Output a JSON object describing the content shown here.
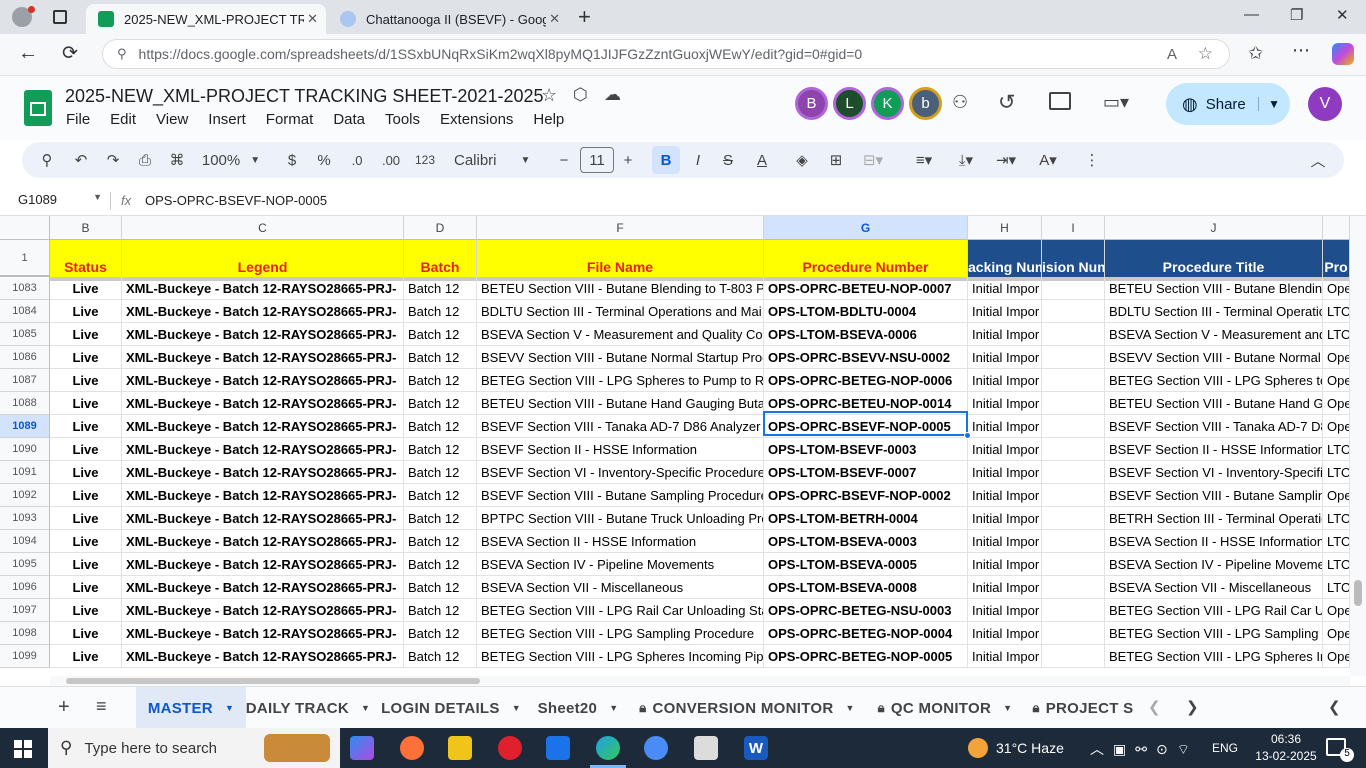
{
  "browser": {
    "tabs": [
      {
        "title": "2025-NEW_XML-PROJECT TRACK",
        "active": true
      },
      {
        "title": "Chattanooga II (BSEVF) - Google",
        "active": false
      }
    ],
    "url": "https://docs.google.com/spreadsheets/d/1SSxbUNqRxSiKm2wqXl8pyMQ1JIJFGzZzntGuoxjWEwY/edit?gid=0#gid=0"
  },
  "doc": {
    "title": "2025-NEW_XML-PROJECT TRACKING SHEET-2021-2025",
    "menu": [
      "File",
      "Edit",
      "View",
      "Insert",
      "Format",
      "Data",
      "Tools",
      "Extensions",
      "Help"
    ],
    "avatars": [
      {
        "letter": "B",
        "color": "#8e44ad"
      },
      {
        "letter": "L",
        "color": "#1e4d2b"
      },
      {
        "letter": "K",
        "color": "#0f9d58"
      },
      {
        "letter": "b",
        "color": "#4a5f7a"
      }
    ],
    "user_avatar": {
      "letter": "V",
      "color": "#8e3ac1"
    },
    "share_label": "Share"
  },
  "toolbar": {
    "zoom": "100%",
    "currency": "$",
    "percent": "%",
    "dec_less": ".0",
    "dec_more": ".00",
    "number_format": "123",
    "font": "Calibri",
    "font_size": "11"
  },
  "formula_bar": {
    "cell_ref": "G1089",
    "fx": "fx",
    "value": "OPS-OPRC-BSEVF-NOP-0005"
  },
  "grid": {
    "header_row_num": "1",
    "columns": [
      {
        "letter": "B",
        "header": "Status"
      },
      {
        "letter": "C",
        "header": "Legend"
      },
      {
        "letter": "D",
        "header": "Batch"
      },
      {
        "letter": "F",
        "header": "File Name"
      },
      {
        "letter": "G",
        "header": "Procedure Number"
      },
      {
        "letter": "H",
        "header": "acking Num"
      },
      {
        "letter": "I",
        "header": "ision Num"
      },
      {
        "letter": "J",
        "header": "Procedure Title"
      },
      {
        "letter": "",
        "header": "Pro"
      }
    ],
    "selected_row": "1089",
    "rows": [
      {
        "num": "1083",
        "status": "Live",
        "legend": "XML-Buckeye - Batch 12-RAYSO28665-PRJ-",
        "batch": "Batch 12",
        "file": "BETEU Section VIII - Butane Blending to T-803 Pu",
        "proc": "OPS-OPRC-BETEU-NOP-0007",
        "track": "Initial Impor",
        "rev": "",
        "title": "BETEU Section VIII - Butane Blending",
        "pro": "Ope"
      },
      {
        "num": "1084",
        "status": "Live",
        "legend": "XML-Buckeye - Batch 12-RAYSO28665-PRJ-",
        "batch": "Batch 12",
        "file": "BDLTU Section III - Terminal Operations and Mai",
        "proc": "OPS-LTOM-BDLTU-0004",
        "track": "Initial Impor",
        "rev": "",
        "title": "BDLTU Section III - Terminal Operatic",
        "pro": "LTO"
      },
      {
        "num": "1085",
        "status": "Live",
        "legend": "XML-Buckeye - Batch 12-RAYSO28665-PRJ-",
        "batch": "Batch 12",
        "file": "BSEVA Section V - Measurement and Quality Co",
        "proc": "OPS-LTOM-BSEVA-0006",
        "track": "Initial Impor",
        "rev": "",
        "title": "BSEVA Section V - Measurement and",
        "pro": "LTO"
      },
      {
        "num": "1086",
        "status": "Live",
        "legend": "XML-Buckeye - Batch 12-RAYSO28665-PRJ-",
        "batch": "Batch 12",
        "file": "BSEVV Section VIII - Butane Normal Startup Proc",
        "proc": "OPS-OPRC-BSEVV-NSU-0002",
        "track": "Initial Impor",
        "rev": "",
        "title": "BSEVV Section VIII - Butane Normal S",
        "pro": "Ope"
      },
      {
        "num": "1087",
        "status": "Live",
        "legend": "XML-Buckeye - Batch 12-RAYSO28665-PRJ-",
        "batch": "Batch 12",
        "file": "BETEG Section VIII - LPG Spheres to Pump to Rai",
        "proc": "OPS-OPRC-BETEG-NOP-0006",
        "track": "Initial Impor",
        "rev": "",
        "title": "BETEG Section VIII - LPG Spheres to",
        "pro": "Ope"
      },
      {
        "num": "1088",
        "status": "Live",
        "legend": "XML-Buckeye - Batch 12-RAYSO28665-PRJ-",
        "batch": "Batch 12",
        "file": "BETEU Section VIII - Butane Hand Gauging Butan",
        "proc": "OPS-OPRC-BETEU-NOP-0014",
        "track": "Initial Impor",
        "rev": "",
        "title": "BETEU Section VIII - Butane Hand Ga",
        "pro": "Ope"
      },
      {
        "num": "1089",
        "status": "Live",
        "legend": "XML-Buckeye - Batch 12-RAYSO28665-PRJ-",
        "batch": "Batch 12",
        "file": "BSEVF Section VIII - Tanaka AD-7 D86 Analyzer C",
        "proc": "OPS-OPRC-BSEVF-NOP-0005",
        "track": "Initial Impor",
        "rev": "",
        "title": "BSEVF Section VIII - Tanaka AD-7 D8",
        "pro": "Ope"
      },
      {
        "num": "1090",
        "status": "Live",
        "legend": "XML-Buckeye - Batch 12-RAYSO28665-PRJ-",
        "batch": "Batch 12",
        "file": "BSEVF Section II - HSSE Information",
        "proc": "OPS-LTOM-BSEVF-0003",
        "track": "Initial Impor",
        "rev": "",
        "title": "BSEVF Section II - HSSE Information",
        "pro": "LTO"
      },
      {
        "num": "1091",
        "status": "Live",
        "legend": "XML-Buckeye - Batch 12-RAYSO28665-PRJ-",
        "batch": "Batch 12",
        "file": "BSEVF Section VI - Inventory-Specific Procedures",
        "proc": "OPS-LTOM-BSEVF-0007",
        "track": "Initial Impor",
        "rev": "",
        "title": "BSEVF Section VI - Inventory-Specific",
        "pro": "LTO"
      },
      {
        "num": "1092",
        "status": "Live",
        "legend": "XML-Buckeye - Batch 12-RAYSO28665-PRJ-",
        "batch": "Batch 12",
        "file": "BSEVF Section VIII - Butane Sampling Procedure",
        "proc": "OPS-OPRC-BSEVF-NOP-0002",
        "track": "Initial Impor",
        "rev": "",
        "title": "BSEVF Section VIII - Butane Sampling",
        "pro": "Ope"
      },
      {
        "num": "1093",
        "status": "Live",
        "legend": "XML-Buckeye - Batch 12-RAYSO28665-PRJ-",
        "batch": "Batch 12",
        "file": "BPTPC Section VIII - Butane Truck Unloading Pro",
        "proc": "OPS-LTOM-BETRH-0004",
        "track": "Initial Impor",
        "rev": "",
        "title": "BETRH Section III - Terminal Operatic",
        "pro": "LTO"
      },
      {
        "num": "1094",
        "status": "Live",
        "legend": "XML-Buckeye - Batch 12-RAYSO28665-PRJ-",
        "batch": "Batch 12",
        "file": "BSEVA Section II - HSSE Information",
        "proc": "OPS-LTOM-BSEVA-0003",
        "track": "Initial Impor",
        "rev": "",
        "title": "BSEVA Section II - HSSE Information",
        "pro": "LTO"
      },
      {
        "num": "1095",
        "status": "Live",
        "legend": "XML-Buckeye - Batch 12-RAYSO28665-PRJ-",
        "batch": "Batch 12",
        "file": "BSEVA Section IV - Pipeline Movements",
        "proc": "OPS-LTOM-BSEVA-0005",
        "track": "Initial Impor",
        "rev": "",
        "title": "BSEVA Section IV - Pipeline Moveme",
        "pro": "LTO"
      },
      {
        "num": "1096",
        "status": "Live",
        "legend": "XML-Buckeye - Batch 12-RAYSO28665-PRJ-",
        "batch": "Batch 12",
        "file": "BSEVA Section VII - Miscellaneous",
        "proc": "OPS-LTOM-BSEVA-0008",
        "track": "Initial Impor",
        "rev": "",
        "title": "BSEVA Section VII - Miscellaneous",
        "pro": "LTO"
      },
      {
        "num": "1097",
        "status": "Live",
        "legend": "XML-Buckeye - Batch 12-RAYSO28665-PRJ-",
        "batch": "Batch 12",
        "file": "BETEG Section VIII - LPG Rail Car Unloading Star",
        "proc": "OPS-OPRC-BETEG-NSU-0003",
        "track": "Initial Impor",
        "rev": "",
        "title": "BETEG Section VIII - LPG Rail Car Unl",
        "pro": "Ope"
      },
      {
        "num": "1098",
        "status": "Live",
        "legend": "XML-Buckeye - Batch 12-RAYSO28665-PRJ-",
        "batch": "Batch 12",
        "file": "BETEG Section VIII - LPG Sampling Procedure",
        "proc": "OPS-OPRC-BETEG-NOP-0004",
        "track": "Initial Impor",
        "rev": "",
        "title": "BETEG Section VIII - LPG Sampling Pr",
        "pro": "Ope"
      },
      {
        "num": "1099",
        "status": "Live",
        "legend": "XML-Buckeye - Batch 12-RAYSO28665-PRJ-",
        "batch": "Batch 12",
        "file": "BETEG Section VIII - LPG Spheres Incoming Pipel",
        "proc": "OPS-OPRC-BETEG-NOP-0005",
        "track": "Initial Impor",
        "rev": "",
        "title": "BETEG Section VIII - LPG Spheres Inc",
        "pro": "Ope"
      }
    ]
  },
  "sheets": {
    "tabs": [
      {
        "label": "MASTER",
        "active": true,
        "locked": false
      },
      {
        "label": "DAILY TRACK",
        "active": false,
        "locked": false
      },
      {
        "label": "LOGIN DETAILS",
        "active": false,
        "locked": false
      },
      {
        "label": "Sheet20",
        "active": false,
        "locked": false
      },
      {
        "label": "CONVERSION MONITOR",
        "active": false,
        "locked": true
      },
      {
        "label": "QC MONITOR",
        "active": false,
        "locked": true
      },
      {
        "label": "PROJECT S",
        "active": false,
        "locked": true
      }
    ]
  },
  "taskbar": {
    "search_placeholder": "Type here to search",
    "weather": "31°C  Haze",
    "lang": "ENG",
    "time": "06:36",
    "date": "13-02-2025",
    "notifications": "5"
  }
}
